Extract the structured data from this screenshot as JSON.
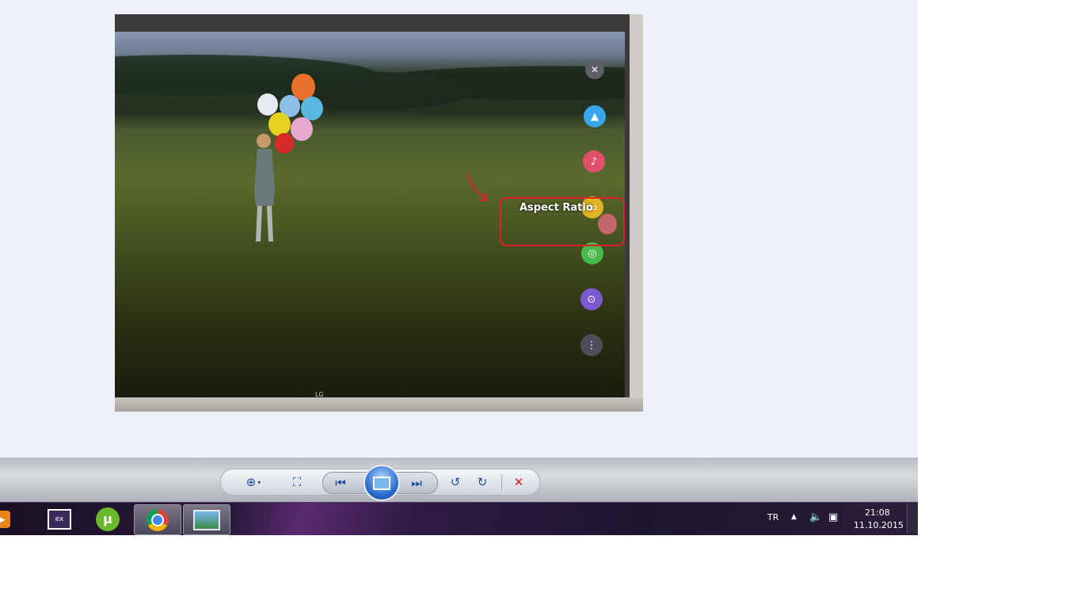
{
  "photo": {
    "tv_overlay": {
      "aspect_label": "Aspect Ratio",
      "brand": "LG",
      "icons": [
        {
          "name": "close-icon",
          "color": "#5e5e66"
        },
        {
          "name": "picture-icon",
          "color": "#38a6e8"
        },
        {
          "name": "sound-icon",
          "color": "#e0506a"
        },
        {
          "name": "aspect-ratio-icon",
          "color": "#e0b228"
        },
        {
          "name": "channel-icon",
          "color": "#48b848"
        },
        {
          "name": "lock-icon",
          "color": "#7a5ad0"
        },
        {
          "name": "more-icon",
          "color": "#4e4e5a"
        }
      ]
    },
    "annotation_color": "#e0202a"
  },
  "toolbar": {
    "icons": [
      "zoom-icon",
      "fit-window-icon",
      "previous-icon",
      "slideshow-icon",
      "next-icon",
      "rotate-left-icon",
      "rotate-right-icon",
      "delete-icon"
    ]
  },
  "taskbar": {
    "apps": [
      "media-player-icon",
      "video-editor-icon",
      "utorrent-icon",
      "chrome-icon",
      "photo-viewer-icon"
    ],
    "language": "TR",
    "time": "21:08",
    "date": "11.10.2015"
  }
}
